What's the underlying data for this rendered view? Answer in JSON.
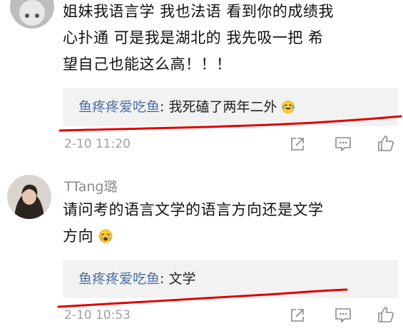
{
  "comments": [
    {
      "text_lines": [
        "姐妹我语言学 我也法语 看到你的成绩我",
        "心扑通 可是我是湖北的 我先吸一把 希",
        "望自己也能这么高！！！"
      ],
      "reply": {
        "name": "鱼疼疼爱吃鱼",
        "colon": ":",
        "text": "我死磕了两年二外",
        "emoji": "laughing-tears-emoji"
      },
      "time": "2-10 11:20"
    },
    {
      "username": "TTang璐",
      "text_lines": [
        "请问考的语言文学的语言方向还是文学",
        "方向"
      ],
      "text_emoji": "crying-face-emoji",
      "reply": {
        "name": "鱼疼疼爱吃鱼",
        "colon": ":",
        "text": "文学"
      },
      "time": "2-10 10:53"
    }
  ],
  "actions": [
    "share-icon",
    "comment-icon",
    "like-icon"
  ],
  "colors": {
    "reply_name": "#4a6fa1",
    "annotation_line": "#e00000",
    "reply_bg": "#f2f2f2"
  }
}
